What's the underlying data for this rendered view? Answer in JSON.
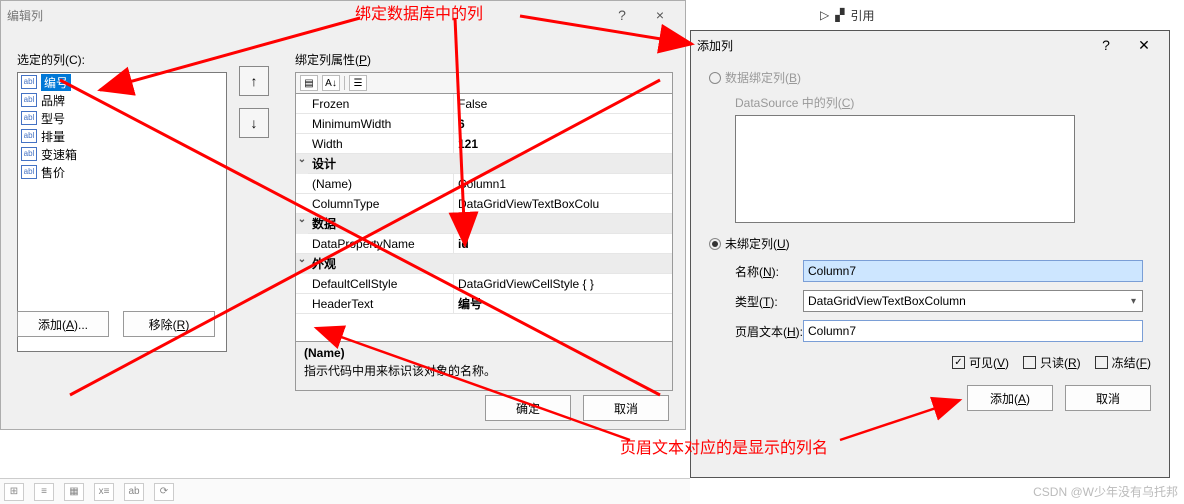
{
  "tree": {
    "yinyong": "引用"
  },
  "dlg1": {
    "title": "编辑列",
    "help": "?",
    "close": "×",
    "selected_cols_label": "选定的列(C):",
    "list": [
      "编号",
      "品牌",
      "型号",
      "排量",
      "变速箱",
      "售价"
    ],
    "btn_add": "添加(A)...",
    "btn_remove": "移除(R)",
    "arrow_up": "↑",
    "arrow_down": "↓",
    "bound_props_label": "绑定列属性(P)",
    "pg": {
      "r_frozen_n": "Frozen",
      "r_frozen_v": "False",
      "r_minw_n": "MinimumWidth",
      "r_minw_v": "6",
      "r_width_n": "Width",
      "r_width_v": "121",
      "cat_design": "设计",
      "r_name_n": "(Name)",
      "r_name_v": "Column1",
      "r_coltype_n": "ColumnType",
      "r_coltype_v": "DataGridViewTextBoxColu",
      "cat_data": "数据",
      "r_dpn_n": "DataPropertyName",
      "r_dpn_v": "id",
      "cat_look": "外观",
      "r_dcs_n": "DefaultCellStyle",
      "r_dcs_v": "DataGridViewCellStyle { }",
      "r_ht_n": "HeaderText",
      "r_ht_v": "编号"
    },
    "desc_name": "(Name)",
    "desc_text": "指示代码中用来标识该对象的名称。",
    "ok": "确定",
    "cancel": "取消"
  },
  "dlg2": {
    "title": "添加列",
    "help": "?",
    "close": "✕",
    "radio_bound": "数据绑定列(B)",
    "bound_sub": "DataSource 中的列(C)",
    "radio_unbound": "未绑定列(U)",
    "name_lbl": "名称(N):",
    "name_val": "Column7",
    "type_lbl": "类型(T):",
    "type_val": "DataGridViewTextBoxColumn",
    "header_lbl": "页眉文本(H):",
    "header_val": "Column7",
    "chk_visible": "可见(V)",
    "chk_readonly": "只读(R)",
    "chk_frozen": "冻结(F)",
    "btn_add": "添加(A)",
    "btn_cancel": "取消"
  },
  "anno1": "绑定数据库中的列",
  "anno2": "页眉文本对应的是显示的列名",
  "watermark": "CSDN @W少年没有乌托邦"
}
